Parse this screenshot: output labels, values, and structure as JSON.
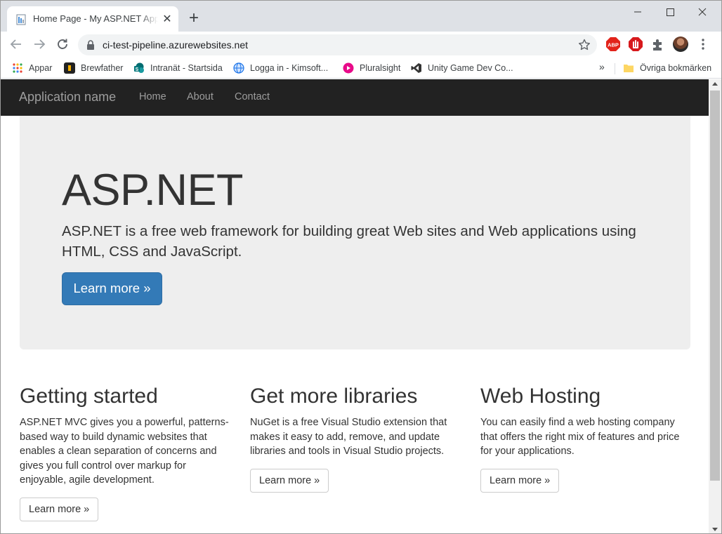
{
  "browser": {
    "tab": {
      "title": "Home Page - My ASP.NET Application",
      "close_symbol": "✕"
    },
    "new_tab_symbol": "+",
    "url": "ci-test-pipeline.azurewebsites.net",
    "extensions": [
      "adblock-plus-icon",
      "red-hand-stop-icon",
      "puzzle-piece-icon",
      "profile-avatar"
    ],
    "bookmarks": [
      {
        "label": "Appar",
        "icon": "apps-grid-icon"
      },
      {
        "label": "Brewfather",
        "icon": "brewfather-icon"
      },
      {
        "label": "Intranät - Startsida",
        "icon": "sharepoint-icon"
      },
      {
        "label": "Logga in - Kimsoft...",
        "icon": "globe-icon"
      },
      {
        "label": "Pluralsight",
        "icon": "pluralsight-icon"
      },
      {
        "label": "Unity Game Dev Co...",
        "icon": "visual-studio-icon"
      }
    ],
    "bookmarks_more": "»",
    "other_bookmarks": "Övriga bokmärken"
  },
  "site": {
    "brand": "Application name",
    "nav": {
      "home": "Home",
      "about": "About",
      "contact": "Contact"
    },
    "jumbotron": {
      "title": "ASP.NET",
      "lead": "ASP.NET is a free web framework for building great Web sites and Web applications using HTML, CSS and JavaScript.",
      "button": "Learn more »"
    },
    "columns": [
      {
        "heading": "Getting started",
        "text": "ASP.NET MVC gives you a powerful, patterns-based way to build dynamic websites that enables a clean separation of concerns and gives you full control over markup for enjoyable, agile development.",
        "button": "Learn more »"
      },
      {
        "heading": "Get more libraries",
        "text": "NuGet is a free Visual Studio extension that makes it easy to add, remove, and update libraries and tools in Visual Studio projects.",
        "button": "Learn more »"
      },
      {
        "heading": "Web Hosting",
        "text": "You can easily find a web hosting company that offers the right mix of features and price for your applications.",
        "button": "Learn more »"
      }
    ]
  },
  "colors": {
    "navbar": "#222222",
    "jumbotron": "#eeeeee",
    "primary": "#337ab7",
    "tabstrip": "#dee1e6"
  }
}
